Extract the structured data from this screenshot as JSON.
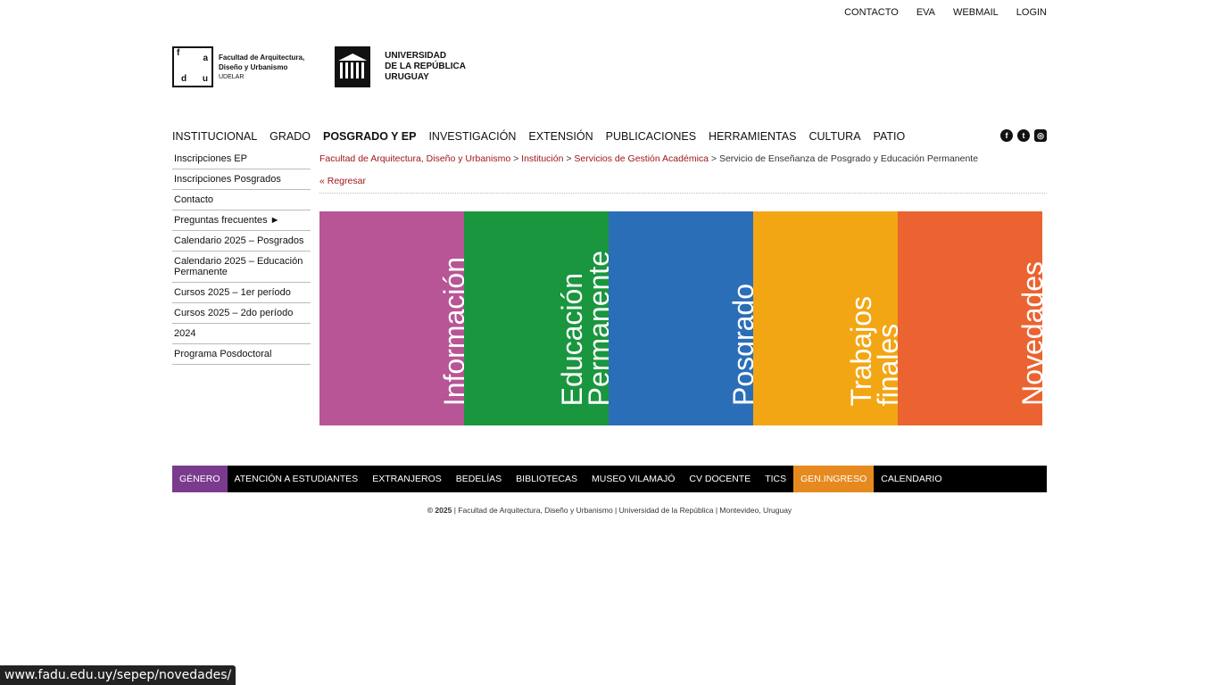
{
  "topbar": [
    "CONTACTO",
    "EVA",
    "WEBMAIL",
    "LOGIN"
  ],
  "logos": {
    "fadu_letters": [
      "f",
      "a",
      "d",
      "u"
    ],
    "fadu_line1": "Facultad de Arquitectura,",
    "fadu_line2": "Diseño y Urbanismo",
    "fadu_line3": "UDELAR",
    "udelar_line1": "UNIVERSIDAD",
    "udelar_line2": "DE LA REPÚBLICA",
    "udelar_line3": "URUGUAY"
  },
  "mainnav": [
    "INSTITUCIONAL",
    "GRADO",
    "POSGRADO Y EP",
    "INVESTIGACIÓN",
    "EXTENSIÓN",
    "PUBLICACIONES",
    "HERRAMIENTAS",
    "CULTURA",
    "PATIO"
  ],
  "social": [
    "f",
    "t",
    "◎"
  ],
  "sidebar": [
    "Inscripciones EP",
    "Inscripciones Posgrados",
    "Contacto",
    "Preguntas frecuentes ►",
    "Calendario 2025 – Posgrados",
    "Calendario 2025 – Educación Permanente",
    "Cursos 2025 – 1er período",
    "Cursos 2025 – 2do período",
    "2024",
    "Programa Posdoctoral"
  ],
  "breadcrumb": {
    "c1": "Facultad de Arquitectura, Diseño y Urbanismo",
    "c2": "Institución",
    "c3": "Servicios de Gestión Académica",
    "current": "Servicio de Enseñanza de Posgrado y Educación Permanente",
    "sep": " > "
  },
  "back": "« Regresar",
  "tiles": [
    {
      "label": "Información",
      "color": "#b75596"
    },
    {
      "label": "Educación\nPermanente",
      "color": "#1a963e"
    },
    {
      "label": "Posgrado",
      "color": "#2a6eb8"
    },
    {
      "label": "Trabajos\nfinales",
      "color": "#f2a614"
    },
    {
      "label": "Novedades",
      "color": "#eb6330"
    }
  ],
  "footnav": [
    "GÉNERO",
    "ATENCIÓN A ESTUDIANTES",
    "EXTRANJEROS",
    "BEDELÍAS",
    "BIBLIOTECAS",
    "MUSEO VILAMAJÓ",
    "CV DOCENTE",
    "TICS",
    "GEN.INGRESO",
    "CALENDARIO"
  ],
  "copyright": {
    "year": "© 2025",
    "rest": " | Facultad de Arquitectura, Diseño y Urbanismo | Universidad de la República | Montevideo, Uruguay"
  },
  "status_url": "www.fadu.edu.uy/sepep/novedades/"
}
